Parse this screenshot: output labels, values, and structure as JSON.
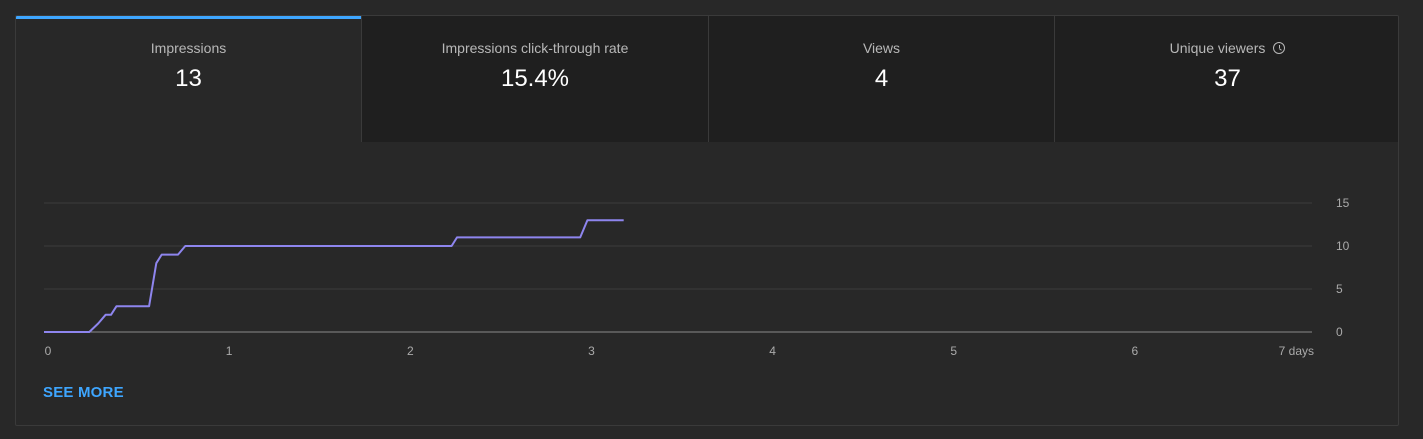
{
  "tabs": [
    {
      "label": "Impressions",
      "value": "13"
    },
    {
      "label": "Impressions click-through rate",
      "value": "15.4%"
    },
    {
      "label": "Views",
      "value": "4"
    },
    {
      "label": "Unique viewers",
      "value": "37"
    }
  ],
  "see_more_label": "SEE MORE",
  "chart_data": {
    "type": "line",
    "title": "",
    "xlabel": "",
    "ylabel": "",
    "x_ticks": [
      "0",
      "1",
      "2",
      "3",
      "4",
      "5",
      "6",
      "7 days"
    ],
    "y_ticks": [
      "0",
      "5",
      "10",
      "15"
    ],
    "xlim": [
      0,
      7
    ],
    "ylim": [
      0,
      15
    ],
    "grid": true,
    "series": [
      {
        "color": "#8e85ee",
        "points": [
          [
            0,
            0
          ],
          [
            0.25,
            0
          ],
          [
            0.3,
            1
          ],
          [
            0.34,
            2
          ],
          [
            0.37,
            2
          ],
          [
            0.4,
            3
          ],
          [
            0.58,
            3
          ],
          [
            0.62,
            8
          ],
          [
            0.65,
            9
          ],
          [
            0.74,
            9
          ],
          [
            0.78,
            10
          ],
          [
            2.25,
            10
          ],
          [
            2.28,
            11
          ],
          [
            2.96,
            11
          ],
          [
            3.0,
            13
          ],
          [
            3.2,
            13
          ]
        ]
      }
    ]
  }
}
